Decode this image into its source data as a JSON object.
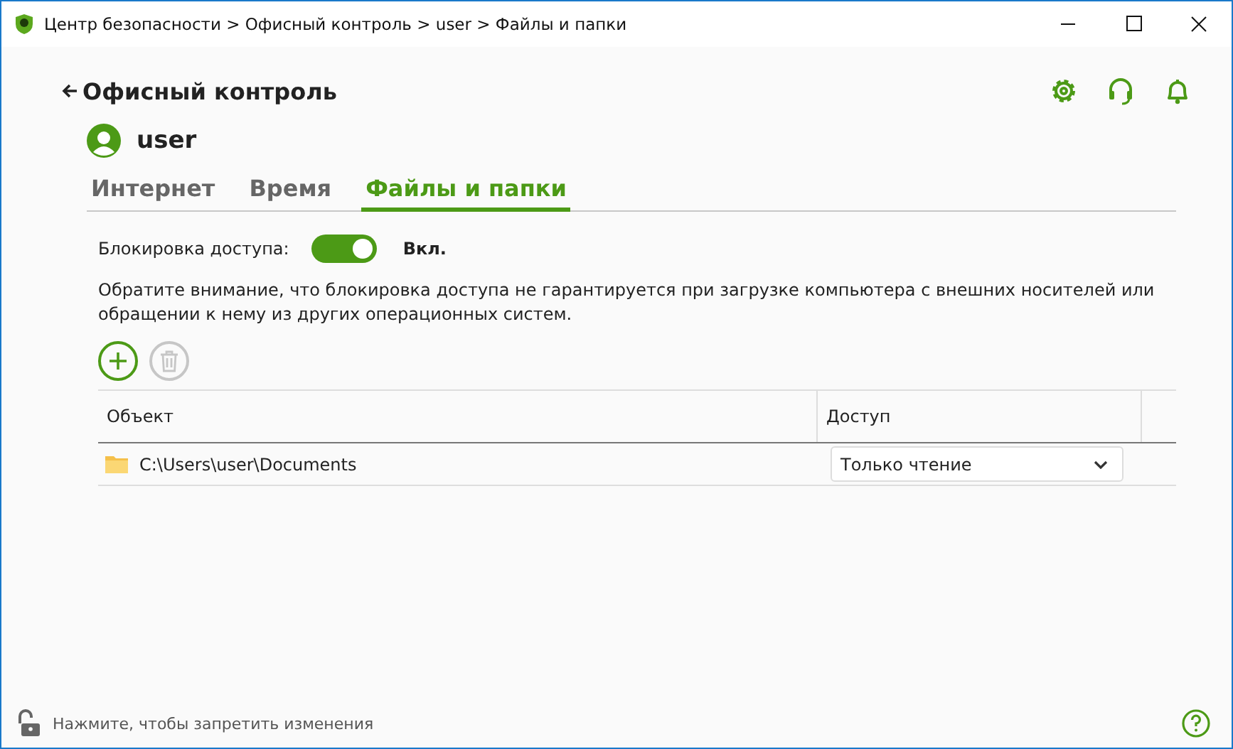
{
  "window": {
    "title": "Центр безопасности > Офисный контроль > user > Файлы и папки"
  },
  "header": {
    "back_label": "Офисный контроль"
  },
  "user": {
    "name": "user"
  },
  "tabs": [
    {
      "label": "Интернет",
      "selected": false
    },
    {
      "label": "Время",
      "selected": false
    },
    {
      "label": "Файлы и папки",
      "selected": true
    }
  ],
  "access_lock": {
    "label": "Блокировка доступа:",
    "on": true,
    "state_label": "Вкл."
  },
  "note": "Обратите внимание, что блокировка доступа не гарантируется при загрузке компьютера с внешних носителей или обращении к нему из других операционных систем.",
  "toolbar": [
    {
      "kind": "add",
      "disabled": false
    },
    {
      "kind": "delete",
      "disabled": true
    }
  ],
  "table": {
    "columns": [
      "Объект",
      "Доступ"
    ],
    "rows": [
      {
        "object": "C:\\Users\\user\\Documents",
        "access": "Только чтение"
      }
    ]
  },
  "footer": {
    "locked": false,
    "text": "Нажмите, чтобы запретить изменения"
  }
}
